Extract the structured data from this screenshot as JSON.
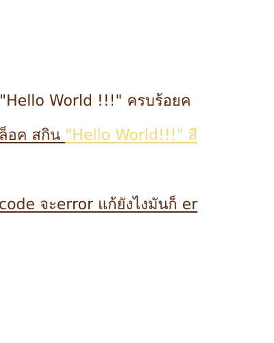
{
  "lines": {
    "line1": "\"Hello World !!!\" ครบร้อยค",
    "line2_part1": "ล็อค สกิน ",
    "line2_part2": "\"Hello World!!!\" สี",
    "line3": "code จะerror แก้ยังไงมันก็ er"
  },
  "colors": {
    "text": "#5b2d12",
    "highlight": "#f0d77a",
    "background": "#ffffff"
  }
}
